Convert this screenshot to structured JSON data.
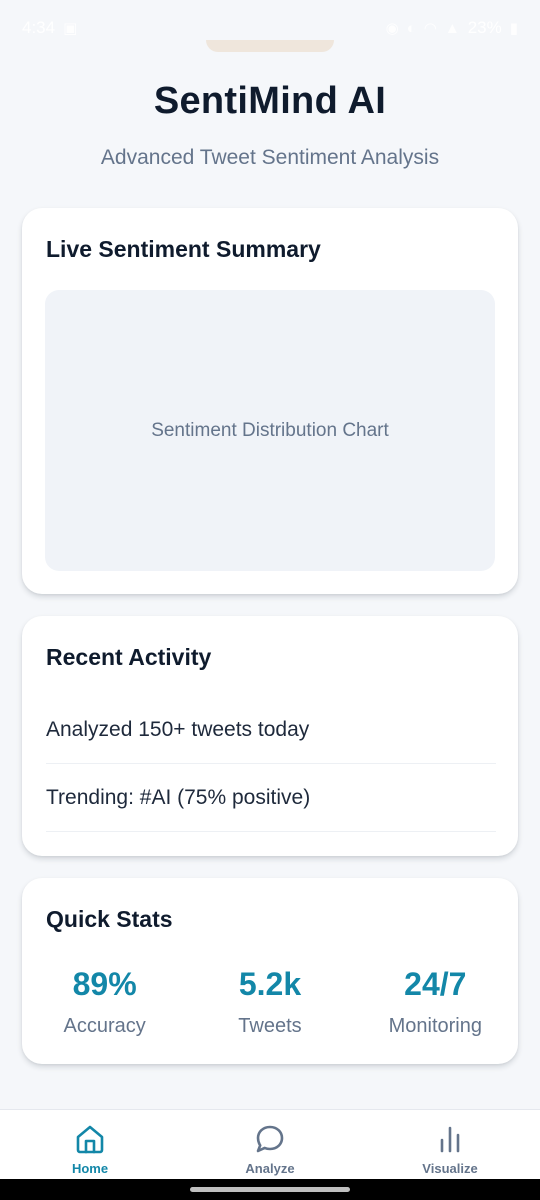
{
  "status_bar": {
    "time": "4:34",
    "battery": "23%",
    "icons": [
      "image-notification-icon",
      "alarm-icon",
      "mute-icon",
      "wifi-icon",
      "signal-icon",
      "battery-icon"
    ]
  },
  "header": {
    "title": "SentiMind AI",
    "subtitle": "Advanced Tweet Sentiment Analysis"
  },
  "summary_card": {
    "title": "Live Sentiment Summary",
    "chart_placeholder": "Sentiment Distribution Chart"
  },
  "activity_card": {
    "title": "Recent Activity",
    "items": [
      "Analyzed 150+ tweets today",
      "Trending: #AI (75% positive)"
    ]
  },
  "stats_card": {
    "title": "Quick Stats",
    "stats": [
      {
        "value": "89%",
        "label": "Accuracy"
      },
      {
        "value": "5.2k",
        "label": "Tweets"
      },
      {
        "value": "24/7",
        "label": "Monitoring"
      }
    ]
  },
  "bottom_nav": {
    "items": [
      {
        "label": "Home",
        "icon": "home-icon",
        "active": true
      },
      {
        "label": "Analyze",
        "icon": "chat-bubble-icon",
        "active": false
      },
      {
        "label": "Visualize",
        "icon": "bar-chart-icon",
        "active": false
      }
    ]
  },
  "colors": {
    "accent": "#1387a8",
    "background": "#f5f7fa",
    "card": "#ffffff",
    "title_text": "#0f1b2d",
    "muted_text": "#64748b",
    "placeholder_bg": "#f0f3f8"
  }
}
